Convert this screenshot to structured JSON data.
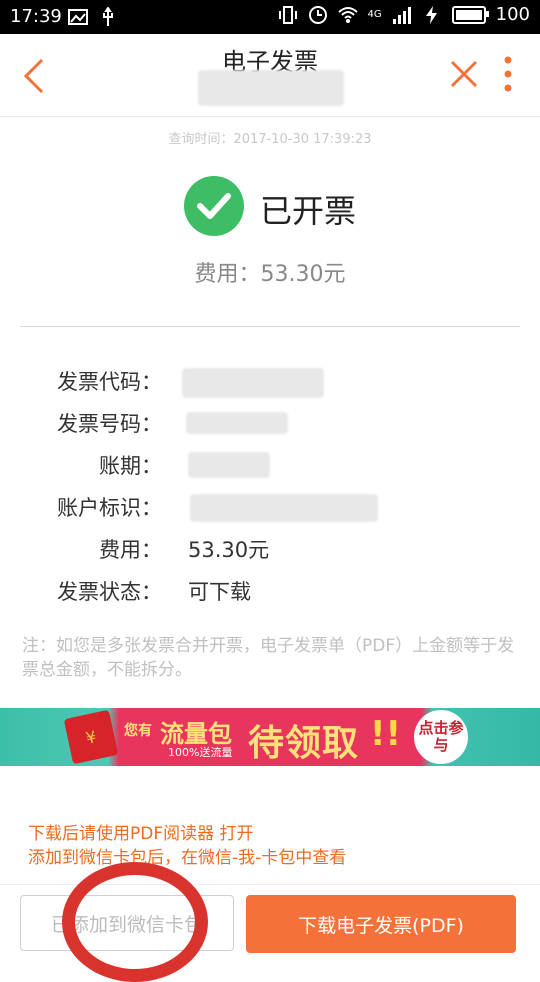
{
  "status_bar": {
    "time": "17:39",
    "network": "4G",
    "battery": "100"
  },
  "header": {
    "title": "电子发票",
    "back_icon": "chevron-left-icon",
    "close_icon": "close-icon",
    "more_icon": "more-vertical-icon"
  },
  "query_time": "查询时间：2017-10-30 17:39:23",
  "invoice_status": {
    "icon": "check-circle-icon",
    "label": "已开票",
    "fee": "费用：53.30元"
  },
  "details": [
    {
      "label": "发票代码：",
      "value": ""
    },
    {
      "label": "发票号码：",
      "value": ""
    },
    {
      "label": "账期：",
      "value": ""
    },
    {
      "label": "账户标识：",
      "value": ""
    },
    {
      "label": "费用：",
      "value": "53.30元"
    },
    {
      "label": "发票状态：",
      "value": "可下载"
    }
  ],
  "note": "注：如您是多张发票合并开票，电子发票单（PDF）上金额等于发票总金额，不能拆分。",
  "banner": {
    "prefix": "您有",
    "main1": "流量包",
    "sub": "100%送流量",
    "main2": "待领取",
    "mark": "!!",
    "cta": "点击参与"
  },
  "hints": {
    "line1": "下载后请使用PDF阅读器 打开",
    "line2": "添加到微信卡包后，在微信-我-卡包中查看"
  },
  "buttons": {
    "add_wechat": "已添加到微信卡包",
    "download": "下载电子发票(PDF)"
  },
  "colors": {
    "accent": "#f4723a",
    "success": "#3ebd64",
    "hint_text": "#f06a1f",
    "annotation": "#d8332d"
  }
}
